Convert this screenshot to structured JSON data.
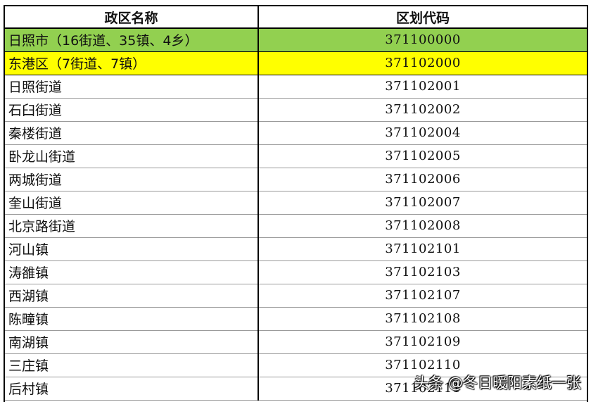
{
  "header": {
    "col_name": "政区名称",
    "col_code": "区划代码"
  },
  "colors": {
    "row_city": "#92d050",
    "row_district": "#ffff00"
  },
  "rows": [
    {
      "name": "日照市（16街道、35镇、4乡）",
      "code": "371100000",
      "highlight": "green"
    },
    {
      "name": "东港区（7街道、7镇）",
      "code": "371102000",
      "highlight": "yellow"
    },
    {
      "name": "日照街道",
      "code": "371102001",
      "highlight": ""
    },
    {
      "name": "石臼街道",
      "code": "371102002",
      "highlight": ""
    },
    {
      "name": "秦楼街道",
      "code": "371102004",
      "highlight": ""
    },
    {
      "name": "卧龙山街道",
      "code": "371102005",
      "highlight": ""
    },
    {
      "name": "两城街道",
      "code": "371102006",
      "highlight": ""
    },
    {
      "name": "奎山街道",
      "code": "371102007",
      "highlight": ""
    },
    {
      "name": "北京路街道",
      "code": "371102008",
      "highlight": ""
    },
    {
      "name": "河山镇",
      "code": "371102101",
      "highlight": ""
    },
    {
      "name": "涛雒镇",
      "code": "371102103",
      "highlight": ""
    },
    {
      "name": "西湖镇",
      "code": "371102107",
      "highlight": ""
    },
    {
      "name": "陈疃镇",
      "code": "371102108",
      "highlight": ""
    },
    {
      "name": "南湖镇",
      "code": "371102109",
      "highlight": ""
    },
    {
      "name": "三庄镇",
      "code": "371102110",
      "highlight": ""
    },
    {
      "name": "后村镇",
      "code": "371102111",
      "highlight": ""
    }
  ],
  "watermark": "头条 @冬日暖阳素纸一张"
}
